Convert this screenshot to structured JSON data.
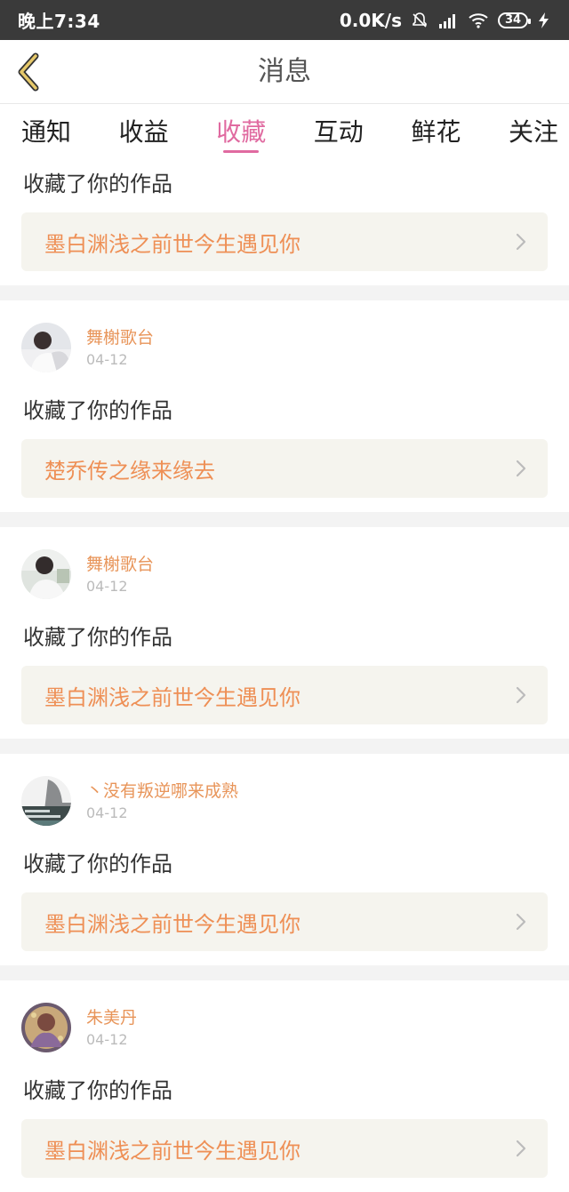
{
  "status": {
    "time": "晚上7:34",
    "speed": "0.0K/s",
    "battery": "34"
  },
  "header": {
    "title": "消息"
  },
  "tabs": [
    {
      "label": "通知"
    },
    {
      "label": "收益"
    },
    {
      "label": "收藏"
    },
    {
      "label": "互动"
    },
    {
      "label": "鲜花"
    },
    {
      "label": "关注"
    }
  ],
  "active_tab": "收藏",
  "first": {
    "action": "收藏了你的作品",
    "work": "墨白渊浅之前世今生遇见你"
  },
  "items": [
    {
      "name": "舞榭歌台",
      "date": "04-12",
      "action": "收藏了你的作品",
      "work": "楚乔传之缘来缘去"
    },
    {
      "name": "舞榭歌台",
      "date": "04-12",
      "action": "收藏了你的作品",
      "work": "墨白渊浅之前世今生遇见你"
    },
    {
      "name": "丶没有叛逆哪来成熟",
      "date": "04-12",
      "action": "收藏了你的作品",
      "work": "墨白渊浅之前世今生遇见你"
    },
    {
      "name": "朱美丹",
      "date": "04-12",
      "action": "收藏了你的作品",
      "work": "墨白渊浅之前世今生遇见你"
    }
  ],
  "colors": {
    "accent_tab": "#e06aa0",
    "username": "#e8955a",
    "work_title": "#ee8f55",
    "work_bg": "#f5f4ee"
  }
}
